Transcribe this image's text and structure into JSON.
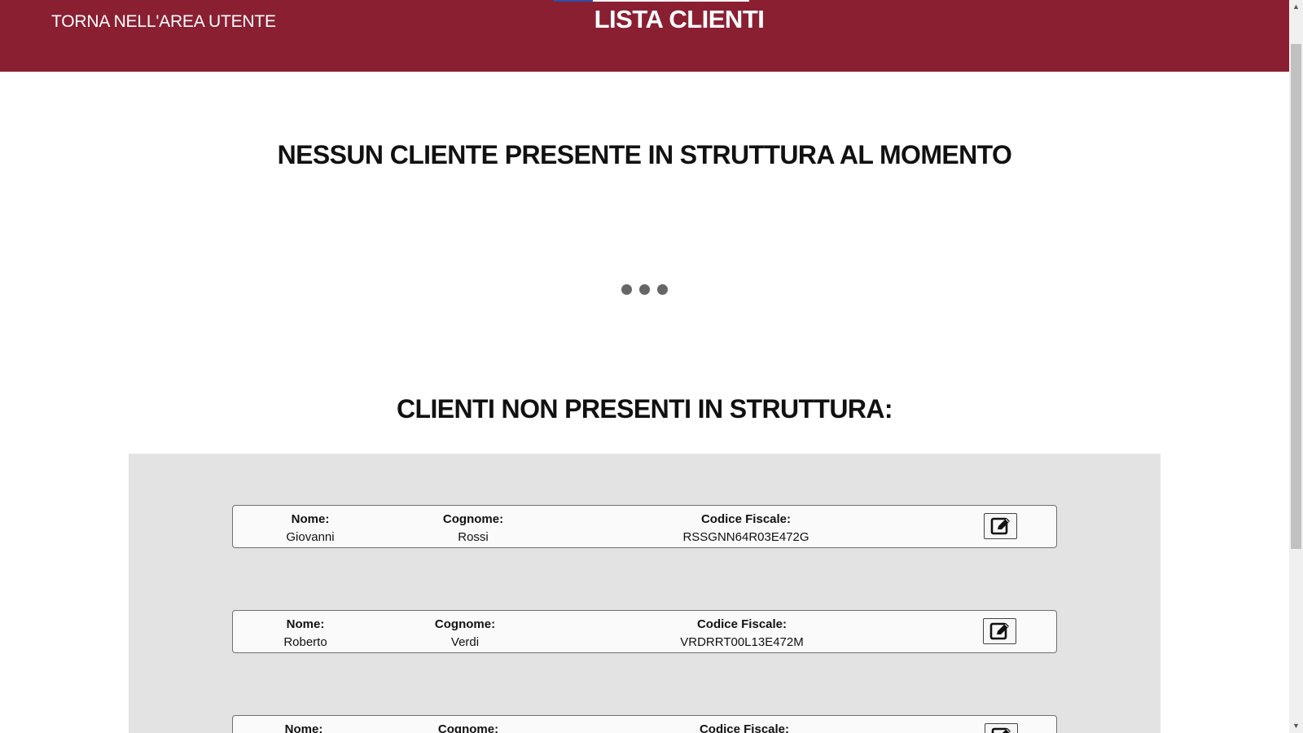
{
  "header": {
    "back_link": "TORNA NELL'AREA UTENTE",
    "title": "LISTA CLIENTI",
    "background_color": "#8a1f32"
  },
  "main": {
    "empty_message": "NESSUN CLIENTE PRESENTE IN STRUTTURA AL MOMENTO",
    "section_title": "CLIENTI NON PRESENTI IN STRUTTURA:"
  },
  "clients": {
    "labels": {
      "nome": "Nome:",
      "cognome": "Cognome:",
      "codice_fiscale": "Codice Fiscale:"
    },
    "items": [
      {
        "nome": "Giovanni",
        "cognome": "Rossi",
        "codice_fiscale": "RSSGNN64R03E472G"
      },
      {
        "nome": "Roberto",
        "cognome": "Verdi",
        "codice_fiscale": "VRDRRT00L13E472M"
      },
      {
        "nome": "",
        "cognome": "",
        "codice_fiscale": ""
      }
    ],
    "edit_icon": "edit-icon"
  },
  "scrollbar": {
    "up_arrow": "▲",
    "down_arrow": "▼"
  }
}
